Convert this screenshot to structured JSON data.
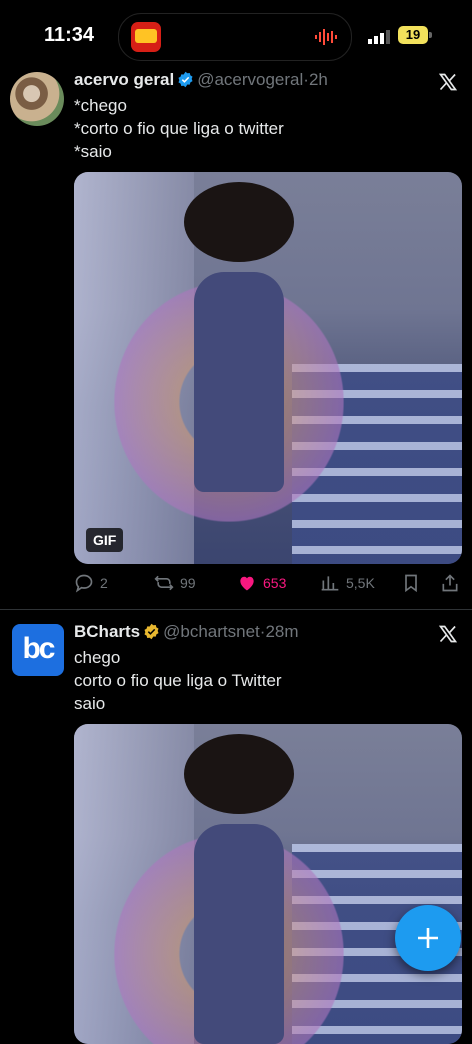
{
  "status_bar": {
    "time": "11:34",
    "battery": "19"
  },
  "tweets": [
    {
      "name": "acervo geral",
      "handle": "@acervogeral",
      "age": "2h",
      "text": "*chego\n*corto o fio que liga o twitter\n*saio",
      "media_badge": "GIF",
      "replies": "2",
      "reposts": "99",
      "likes": "653",
      "views": "5,5K"
    },
    {
      "name": "BCharts",
      "handle": "@bchartsnet",
      "age": "28m",
      "avatar_text": "bc",
      "text": "chego\ncorto o fio que liga o Twitter\nsaio"
    }
  ],
  "colors": {
    "accent": "#1d9bf0",
    "like": "#f91880",
    "muted": "#71767b",
    "gold_badge": "#e8b830"
  },
  "icons": [
    "x-logo-icon",
    "verified-icon",
    "reply-icon",
    "repost-icon",
    "heart-icon",
    "views-icon",
    "bookmark-icon",
    "share-icon",
    "plus-icon"
  ]
}
